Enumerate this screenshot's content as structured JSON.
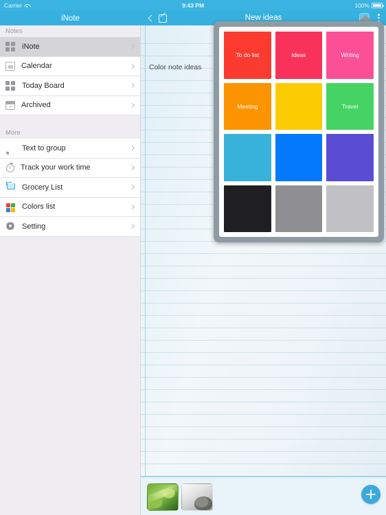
{
  "status_bar": {
    "carrier": "Carrier",
    "wifi_icon": "wifi-icon",
    "time": "9:43 PM",
    "battery_percent": "100%",
    "battery_icon": "battery-icon"
  },
  "sidebar": {
    "title": "iNote",
    "sections": [
      {
        "header": "Notes",
        "items": [
          {
            "label": "iNote",
            "icon": "grid-four-icon",
            "selected": true,
            "chevron": "chevron-right-icon"
          },
          {
            "label": "Calendar",
            "icon": "calendar-icon",
            "selected": false,
            "chevron": "chevron-right-icon"
          },
          {
            "label": "Today Board",
            "icon": "grid-four-icon",
            "selected": false,
            "chevron": "chevron-right-icon"
          },
          {
            "label": "Archived",
            "icon": "archive-box-icon",
            "selected": false,
            "chevron": "chevron-right-icon"
          }
        ]
      },
      {
        "header": "More",
        "items": [
          {
            "label": "Text to group",
            "icon": "speech-bubble-icon",
            "selected": false,
            "chevron": "chevron-right-icon"
          },
          {
            "label": "Track your work time",
            "icon": "stopwatch-icon",
            "selected": false,
            "chevron": "chevron-right-icon"
          },
          {
            "label": "Grocery List",
            "icon": "shopping-cart-icon",
            "selected": false,
            "chevron": "chevron-right-icon"
          },
          {
            "label": "Colors list",
            "icon": "color-squares-icon",
            "selected": false,
            "chevron": "chevron-right-icon"
          },
          {
            "label": "Setting",
            "icon": "gear-icon",
            "selected": false,
            "chevron": "chevron-right-icon"
          }
        ]
      }
    ]
  },
  "note_navbar": {
    "back_icon": "chevron-left-icon",
    "compose_icon": "compose-pencil-icon",
    "title": "New ideas",
    "palette_icon": "color-palette-button",
    "overflow_icon": "more-vertical-icon"
  },
  "note": {
    "title_text": "Color note ideas"
  },
  "color_popup": {
    "swatches": [
      {
        "label": "To do list",
        "color": "#fb3b30"
      },
      {
        "label": "Ideas",
        "color": "#f9325c"
      },
      {
        "label": "Writing",
        "color": "#fb4f96"
      },
      {
        "label": "Meeting",
        "color": "#fb9400"
      },
      {
        "label": "",
        "color": "#fdcb02"
      },
      {
        "label": "Travel",
        "color": "#45d364"
      },
      {
        "label": "",
        "color": "#38b2da"
      },
      {
        "label": "",
        "color": "#0579fc"
      },
      {
        "label": "",
        "color": "#5a4dd4"
      },
      {
        "label": "",
        "color": "#1f1f23"
      },
      {
        "label": "",
        "color": "#8e8e93"
      },
      {
        "label": "",
        "color": "#c0c0c5"
      }
    ]
  },
  "bottom_bar": {
    "attachments": [
      {
        "name": "green-plant-photo"
      },
      {
        "name": "frog-photo"
      }
    ],
    "add_button_icon": "plus-icon"
  }
}
